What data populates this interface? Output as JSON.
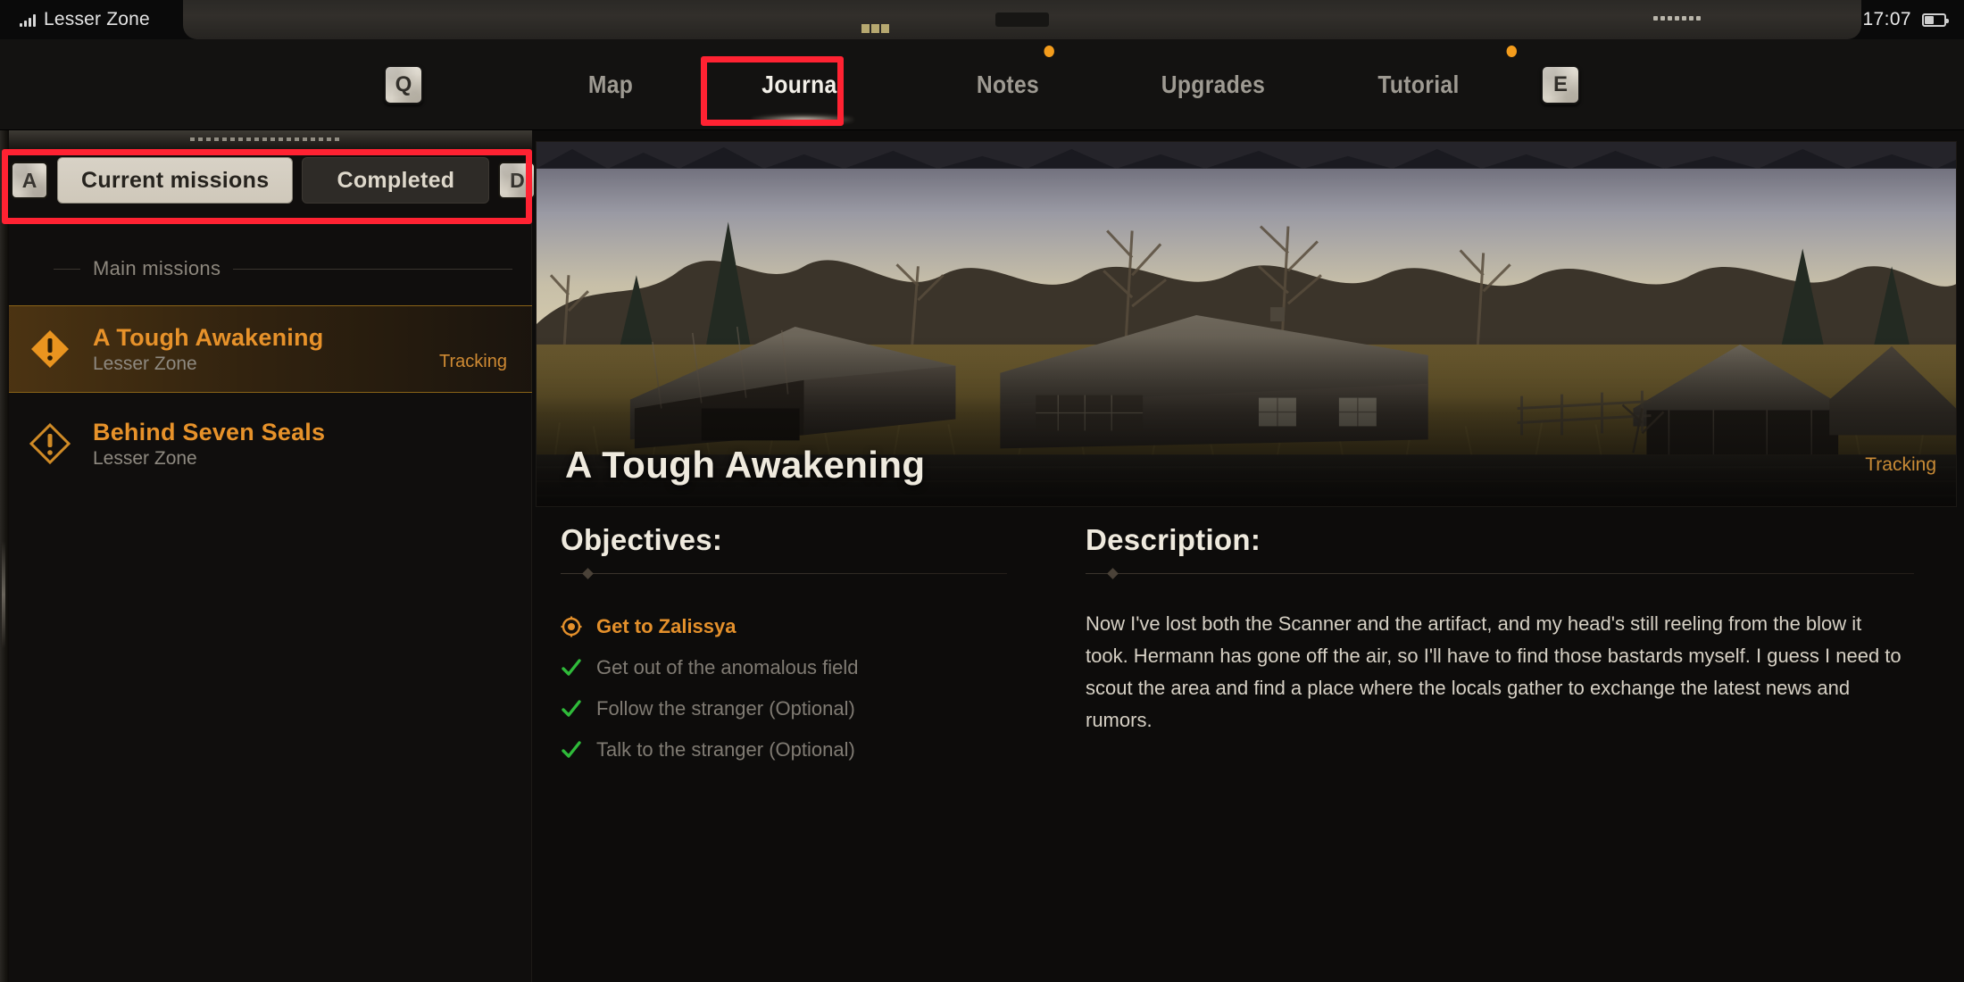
{
  "system_bar": {
    "signal_icon": "signal-bars-icon",
    "zone_label": "Lesser Zone",
    "time": "17:07",
    "battery_icon": "battery-icon"
  },
  "nav": {
    "left_key": "Q",
    "right_key": "E",
    "tabs": [
      {
        "label": "Map",
        "active": false,
        "has_dot": false
      },
      {
        "label": "Journal",
        "active": true,
        "has_dot": false,
        "highlighted": true
      },
      {
        "label": "Notes",
        "active": false,
        "has_dot": true
      },
      {
        "label": "Upgrades",
        "active": false,
        "has_dot": false
      },
      {
        "label": "Tutorial",
        "active": false,
        "has_dot": true
      }
    ]
  },
  "left_panel": {
    "prev_key": "A",
    "next_key": "D",
    "segment_tabs": [
      {
        "label": "Current missions",
        "active": true
      },
      {
        "label": "Completed",
        "active": false
      }
    ],
    "section_label": "Main missions",
    "missions": [
      {
        "title": "A Tough Awakening",
        "zone": "Lesser Zone",
        "tracking_label": "Tracking",
        "selected": true,
        "icon": "exclamation-diamond-filled-icon"
      },
      {
        "title": "Behind Seven Seals",
        "zone": "Lesser Zone",
        "tracking_label": "",
        "selected": false,
        "icon": "exclamation-diamond-outline-icon"
      }
    ]
  },
  "detail": {
    "banner_title": "A Tough Awakening",
    "banner_tracking": "Tracking",
    "objectives_heading": "Objectives:",
    "objectives": [
      {
        "label": "Get to Zalissya",
        "state": "active",
        "icon": "target-icon"
      },
      {
        "label": "Get out of the anomalous field",
        "state": "done",
        "icon": "check-icon"
      },
      {
        "label": "Follow the stranger (Optional)",
        "state": "done",
        "icon": "check-icon"
      },
      {
        "label": "Talk to the stranger (Optional)",
        "state": "done",
        "icon": "check-icon"
      }
    ],
    "description_heading": "Description:",
    "description_text": "Now I've lost both the Scanner and the artifact, and my head's still reeling from the blow it took. Hermann has gone off the air, so I'll have to find those bastards myself. I guess I need to scout the area and find a place where the locals gather to exchange the latest news and rumors."
  },
  "annotations": {
    "highlight_color": "#ff2232",
    "boxes": [
      "journal-tab",
      "mission-filter-tabs"
    ]
  },
  "colors": {
    "accent_orange": "#e7922a",
    "done_green": "#2fbb3a",
    "panel_bg": "#100e0d",
    "text_light": "#efeade",
    "text_muted": "#8d877d"
  }
}
